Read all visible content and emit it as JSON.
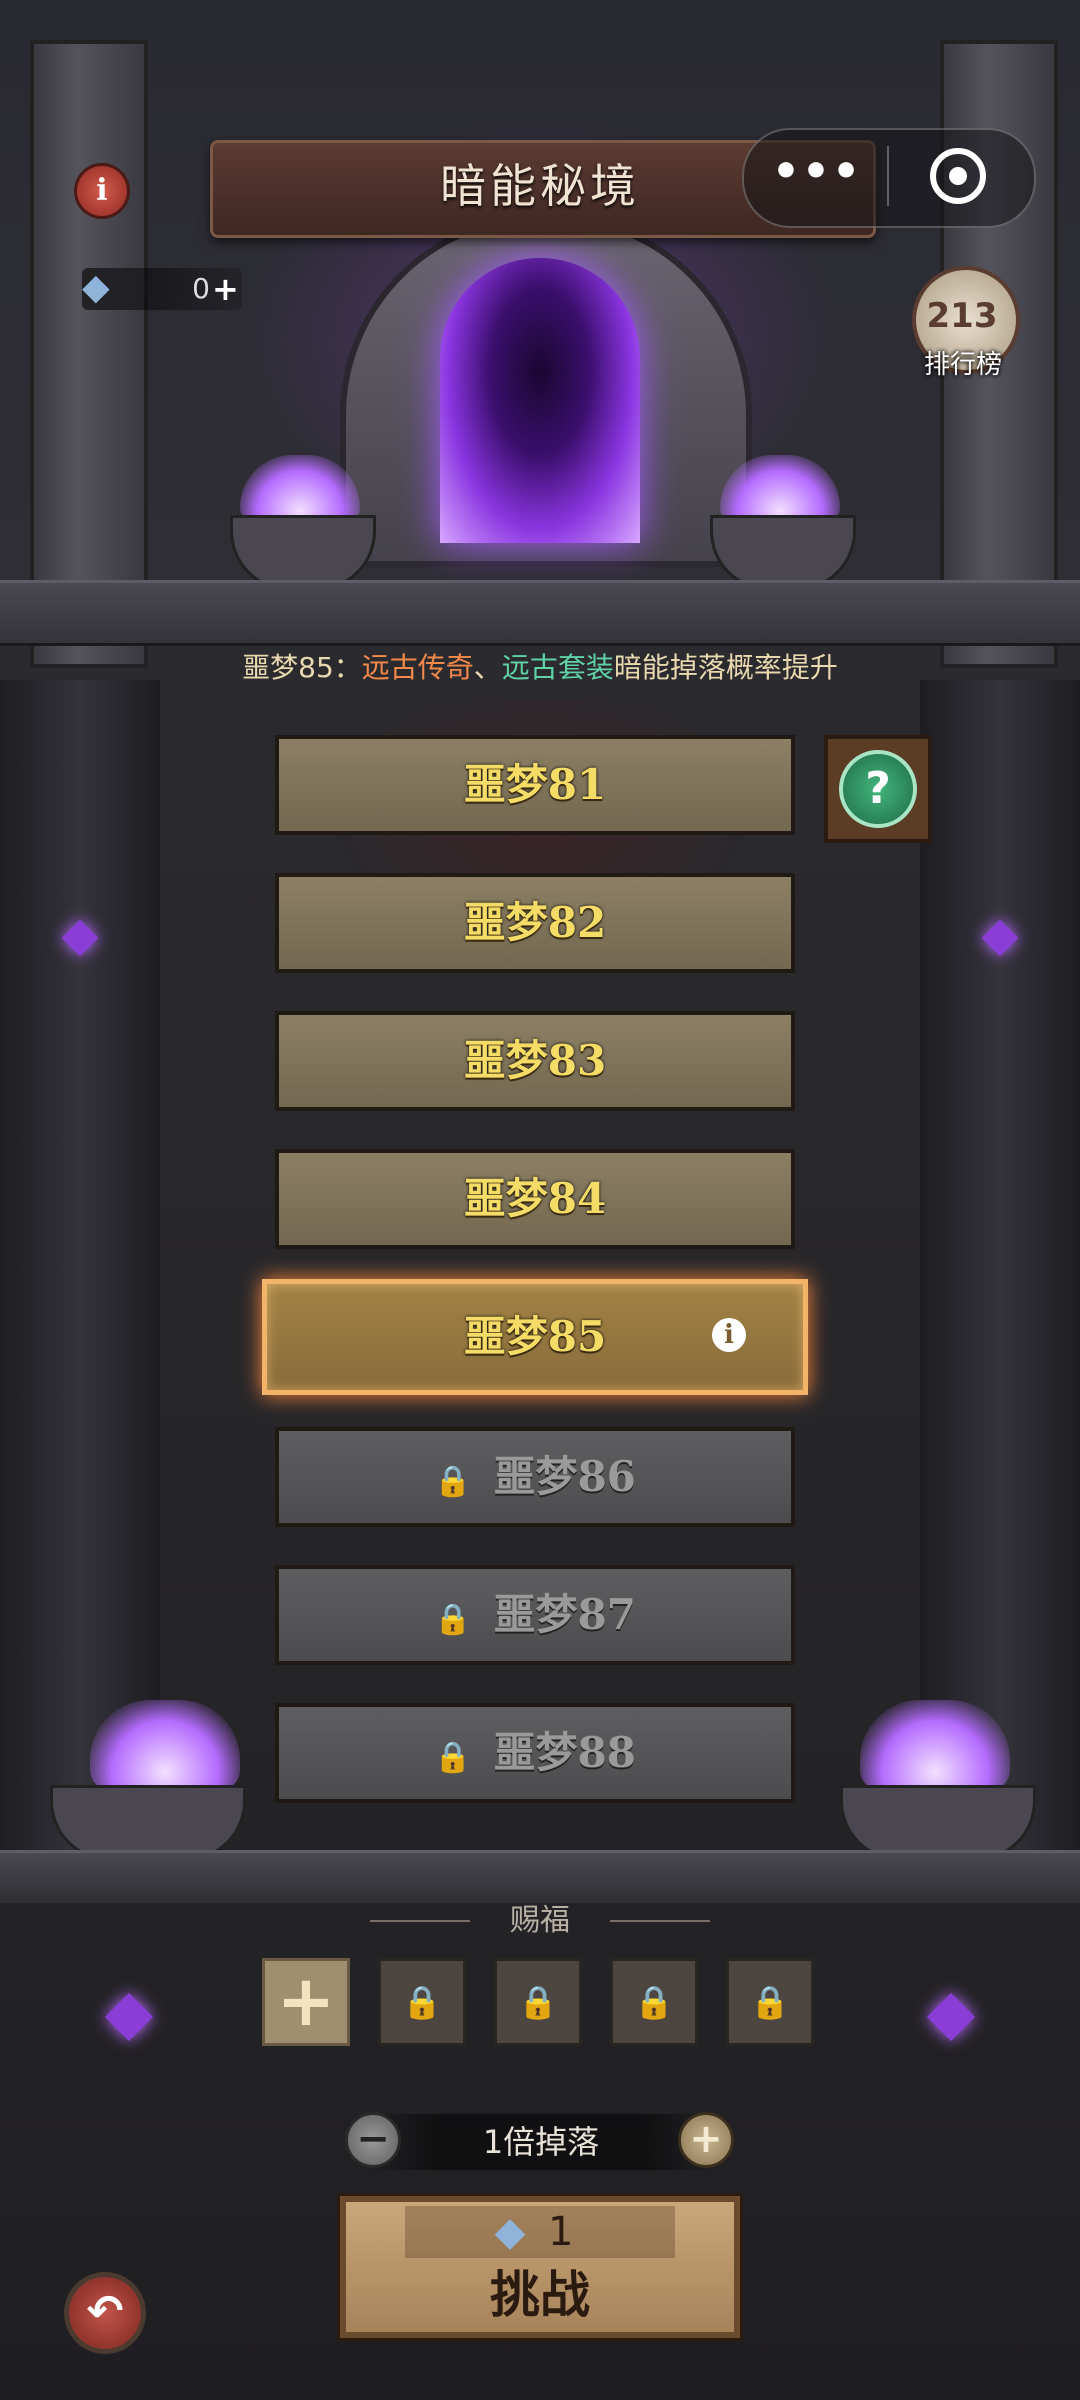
{
  "header": {
    "title": "暗能秘境",
    "info_icon": "info-icon",
    "more_label": "•••",
    "close_icon": "target-close-icon"
  },
  "currency": {
    "icon": "crystal-shard-icon",
    "value": "0",
    "add_label": "+"
  },
  "leaderboard": {
    "icon": "podium-cubes-icon",
    "cubes": "213",
    "label": "排行榜"
  },
  "bonus": {
    "stage": "噩梦85：",
    "item1": "远古传奇",
    "separator": "、",
    "item2": "远古套装",
    "tail": "暗能掉落概率提升",
    "colors": {
      "item1": "#f2894a",
      "item2": "#5fd3a6",
      "base": "#e8d9b0"
    }
  },
  "levels": [
    {
      "label": "噩梦81",
      "state": "unlocked"
    },
    {
      "label": "噩梦82",
      "state": "unlocked"
    },
    {
      "label": "噩梦83",
      "state": "unlocked"
    },
    {
      "label": "噩梦84",
      "state": "unlocked"
    },
    {
      "label": "噩梦85",
      "state": "selected"
    },
    {
      "label": "噩梦86",
      "state": "locked"
    },
    {
      "label": "噩梦87",
      "state": "locked"
    },
    {
      "label": "噩梦88",
      "state": "locked"
    }
  ],
  "mystery_button": {
    "icon": "question-mark-icon",
    "label": "?"
  },
  "blessing": {
    "label": "赐福",
    "add_label": "+",
    "locked_slots": 4,
    "lock_icon": "lock-icon"
  },
  "drop": {
    "minus_label": "−",
    "text": "1倍掉落",
    "plus_label": "+"
  },
  "challenge": {
    "cost_icon": "crystal-shard-icon",
    "cost": "1",
    "label": "挑战"
  },
  "back_button": {
    "icon": "back-arrow-icon",
    "label": "↶"
  },
  "colors": {
    "level_text": "#f4dc66",
    "level_locked_text": "#9a9a9a",
    "selected_border": "#f3b469",
    "portal_glow": "#a45cff"
  }
}
